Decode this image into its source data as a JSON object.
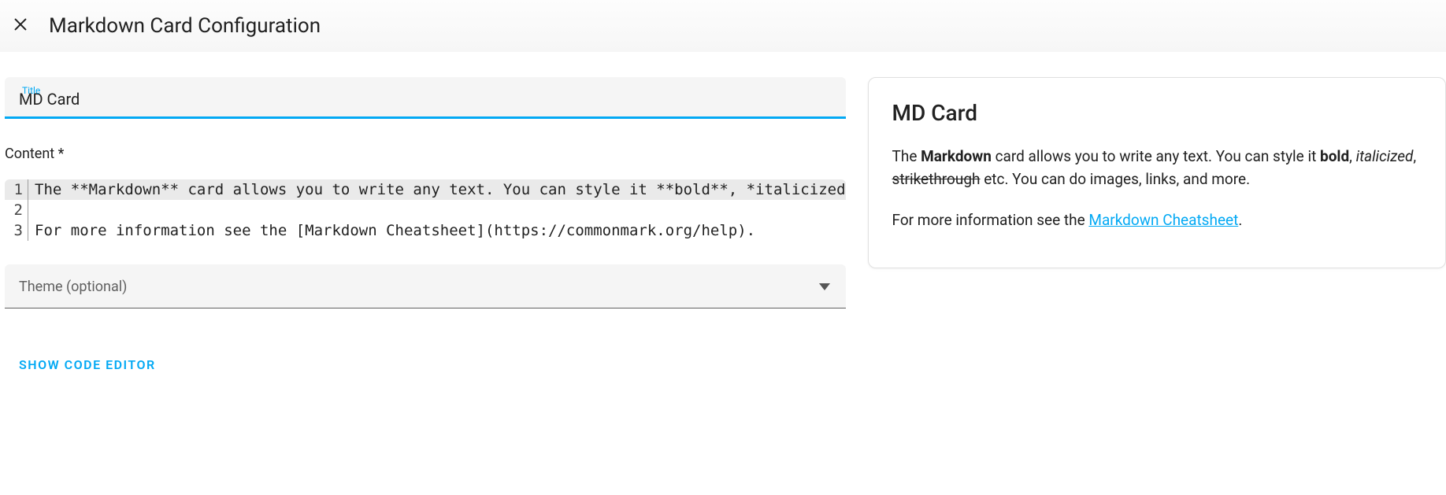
{
  "header": {
    "title": "Markdown Card Configuration"
  },
  "title_field": {
    "label": "Title",
    "value": "MD Card"
  },
  "content_label": "Content *",
  "editor": {
    "lines": [
      "The **Markdown** card allows you to write any text. You can style it **bold**, *italicized",
      "",
      "For more information see the [Markdown Cheatsheet](https://commonmark.org/help)."
    ]
  },
  "theme_field": {
    "placeholder": "Theme (optional)"
  },
  "show_code_button": "Show Code Editor",
  "preview": {
    "title": "MD Card",
    "para1_pre": "The ",
    "para1_bold1": "Markdown",
    "para1_mid1": " card allows you to write any text. You can style it ",
    "para1_bold2": "bold",
    "para1_sep1": ", ",
    "para1_italic": "italicized",
    "para1_sep2": ", ",
    "para1_strike": "strikethrough",
    "para1_tail": " etc. You can do images, links, and more.",
    "para2_pre": "For more information see the ",
    "para2_link_text": "Markdown Cheatsheet",
    "para2_tail": "."
  },
  "colors": {
    "accent": "#03a9f4"
  }
}
